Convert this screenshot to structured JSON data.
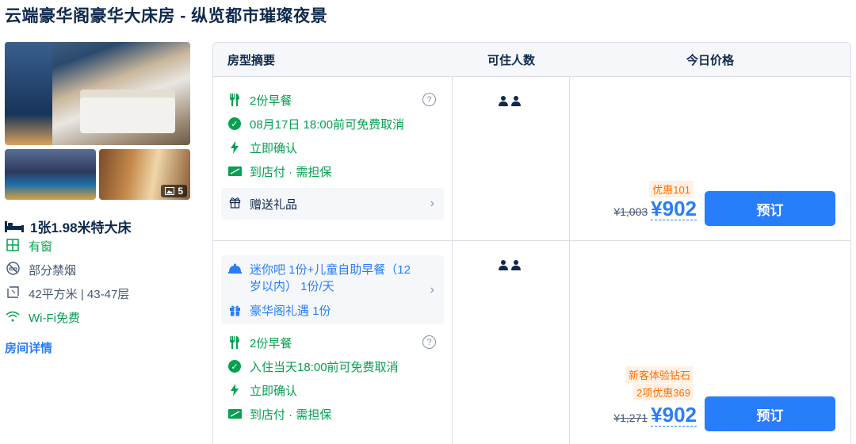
{
  "page": {
    "title": "云端豪华阁豪华大床房 - 纵览都市璀璨夜景"
  },
  "room": {
    "photo_count": "5",
    "bed_type": "1张1.98米特大床",
    "features": [
      {
        "icon": "window-icon",
        "label": "有窗",
        "color": "green"
      },
      {
        "icon": "no-smoking-icon",
        "label": "部分禁烟",
        "color": "gray"
      },
      {
        "icon": "area-icon",
        "label": "42平方米 | 43-47层",
        "color": "gray"
      },
      {
        "icon": "wifi-icon",
        "label": "Wi-Fi免费",
        "color": "green"
      }
    ],
    "detail_link": "房间详情"
  },
  "table": {
    "headers": {
      "summary": "房型摘要",
      "guests": "可住人数",
      "price": "今日价格"
    }
  },
  "offers": [
    {
      "breakfast": "2份早餐",
      "cancel": "08月17日 18:00前可免费取消",
      "confirm": "立即确认",
      "payment": "到店付 · 需担保",
      "gift": "赠送礼品",
      "discount_tag": "优惠101",
      "price_old": "¥1,003",
      "price_now": "¥902",
      "book_label": "预订"
    },
    {
      "package_line1": "迷你吧 1份+儿童自助早餐（12岁以内） 1份/天",
      "package_line2": "豪华阁礼遇 1份",
      "breakfast": "2份早餐",
      "cancel": "入住当天18:00前可免费取消",
      "confirm": "立即确认",
      "payment": "到店付 · 需担保",
      "promo_tag": "新客体验钻石",
      "discount_tag": "2项优惠369",
      "price_old": "¥1,271",
      "price_now": "¥902",
      "book_label": "预订"
    }
  ],
  "colors": {
    "accent": "#287dfa",
    "green": "#06a050",
    "orange": "#ff6f00",
    "text": "#0f294d"
  }
}
